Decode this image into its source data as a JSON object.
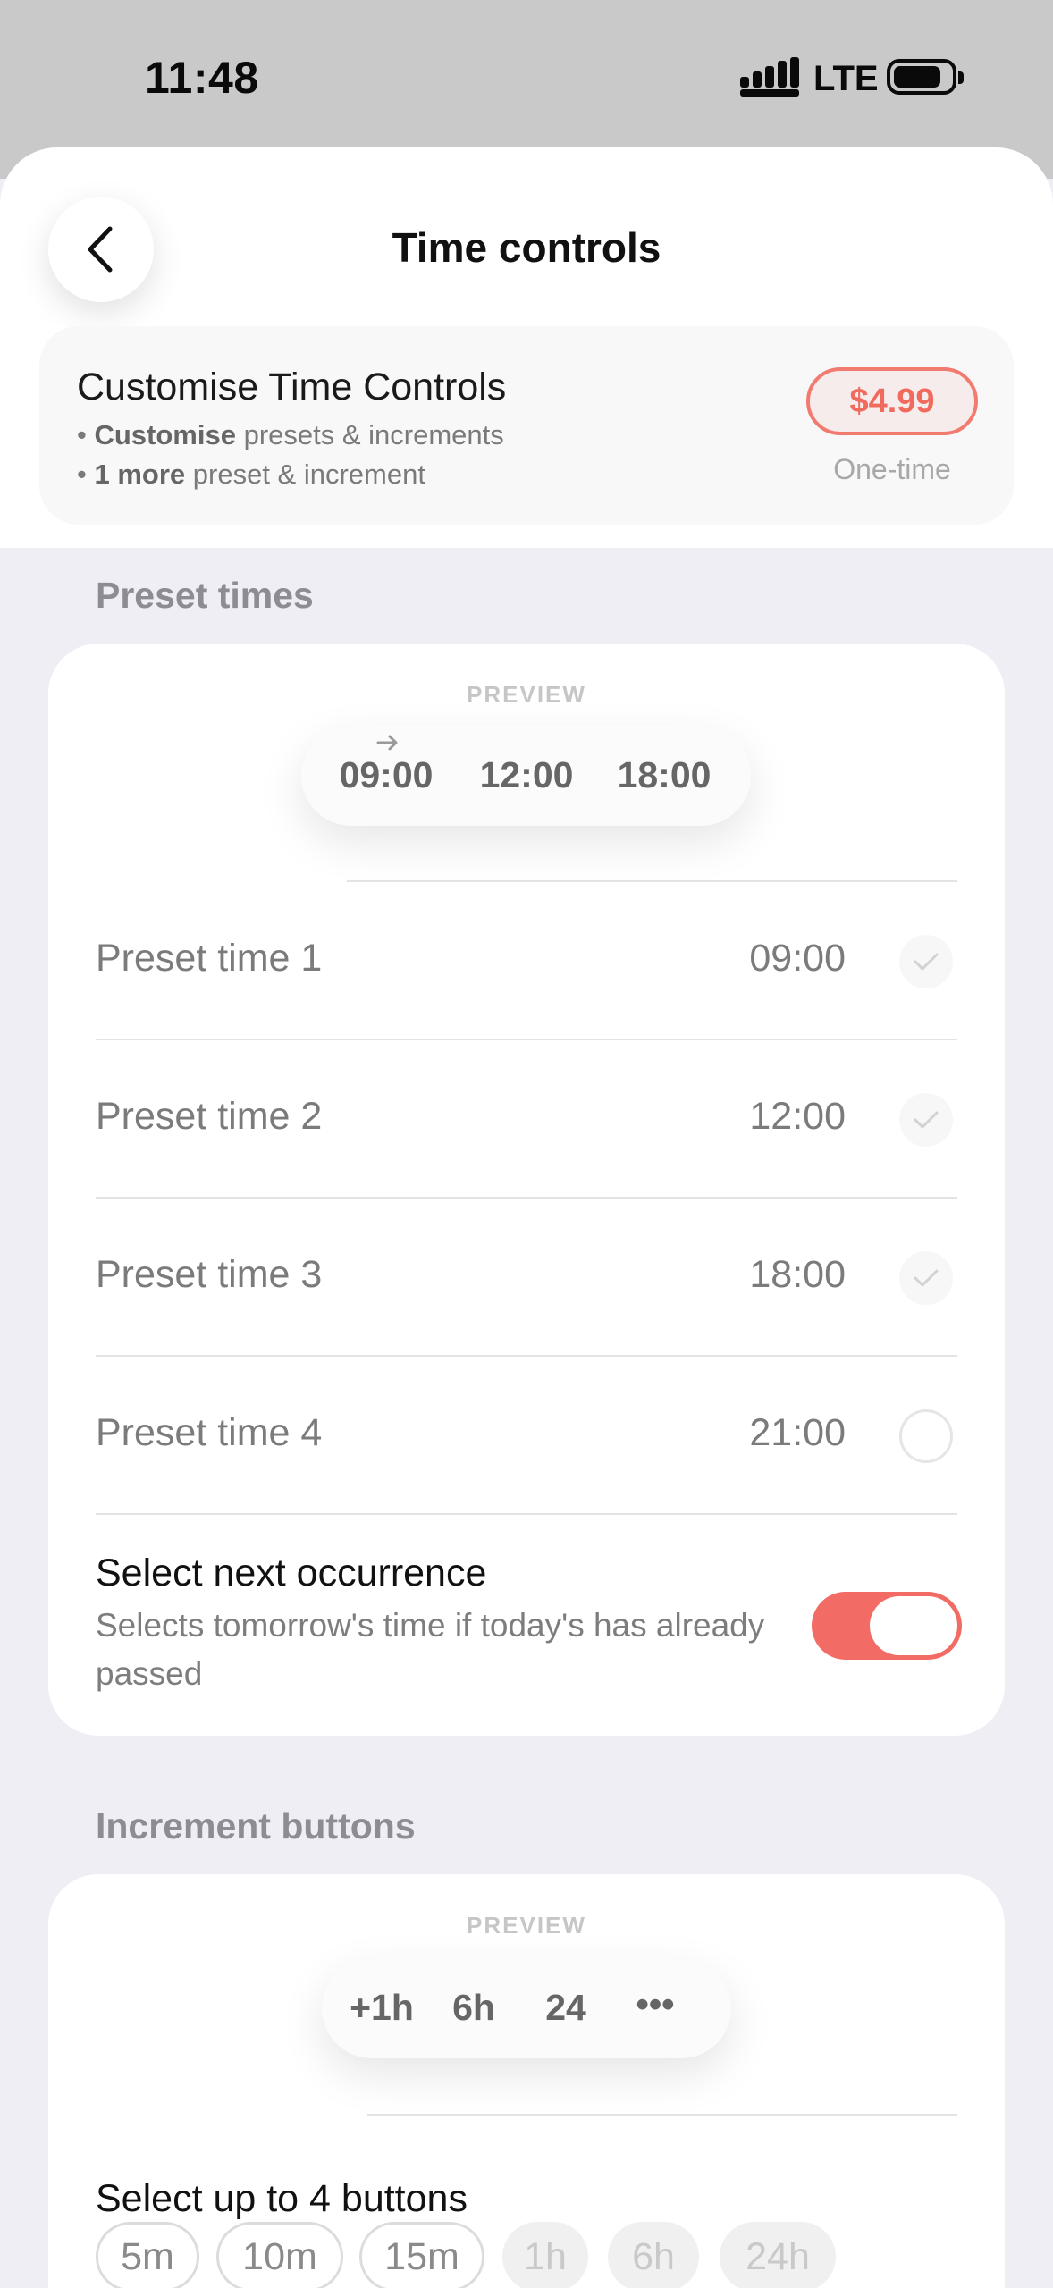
{
  "status_bar": {
    "time": "11:48",
    "network": "LTE"
  },
  "header": {
    "title": "Time controls",
    "back_icon": "chevron-left-icon"
  },
  "upsell": {
    "title": "Customise Time Controls",
    "line1_bold": "Customise",
    "line1_rest": " presets & increments",
    "line2_bold": "1 more",
    "line2_rest": " preset & increment",
    "bullet": "•",
    "price": "$4.99",
    "price_note": "One-time"
  },
  "preset_section": {
    "label": "Preset times",
    "preview_label": "PREVIEW",
    "preview_items": [
      "09:00",
      "12:00",
      "18:00"
    ],
    "rows": [
      {
        "label": "Preset time 1",
        "value": "09:00",
        "checked": true
      },
      {
        "label": "Preset time 2",
        "value": "12:00",
        "checked": true
      },
      {
        "label": "Preset time 3",
        "value": "18:00",
        "checked": true
      },
      {
        "label": "Preset time 4",
        "value": "21:00",
        "checked": false
      }
    ],
    "toggle": {
      "title": "Select next occurrence",
      "description": "Selects tomorrow's time if today's has already passed",
      "on": true
    }
  },
  "increment_section": {
    "label": "Increment buttons",
    "preview_label": "PREVIEW",
    "preview_items": [
      "+1h",
      "6h",
      "24",
      "•••"
    ],
    "select_title": "Select up to 4 buttons",
    "chips": [
      {
        "label": "5m",
        "enabled": true
      },
      {
        "label": "10m",
        "enabled": true
      },
      {
        "label": "15m",
        "enabled": true
      },
      {
        "label": "1h",
        "enabled": false
      },
      {
        "label": "6h",
        "enabled": false
      },
      {
        "label": "24h",
        "enabled": false
      }
    ]
  },
  "colors": {
    "accent": "#f26b64",
    "background": "#efeef4",
    "card": "#ffffff"
  }
}
